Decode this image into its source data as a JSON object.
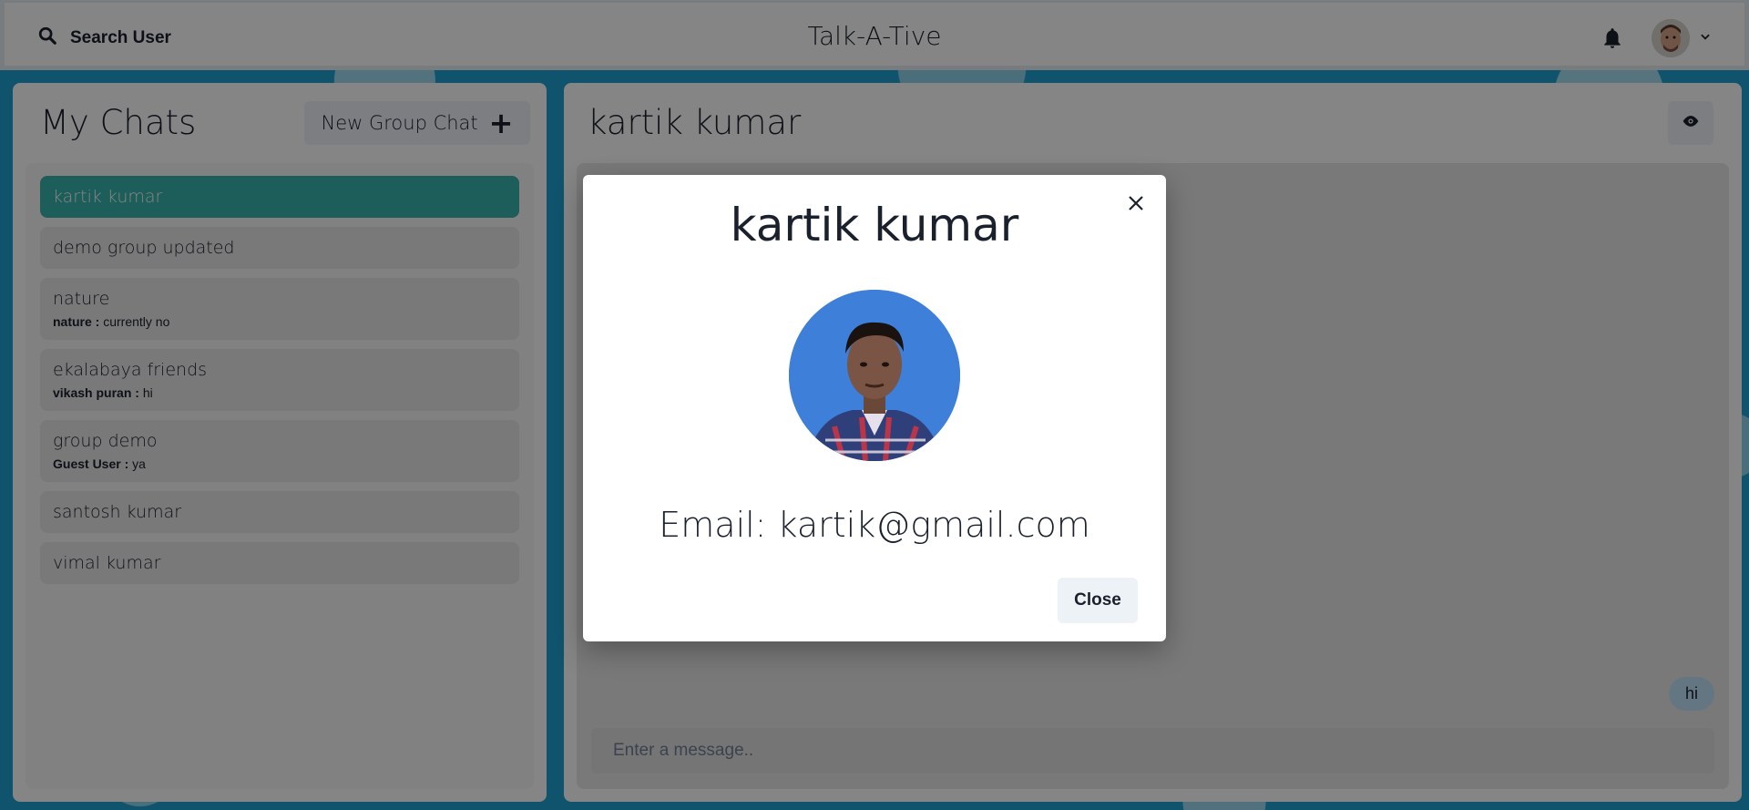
{
  "header": {
    "search_label": "Search User",
    "app_title": "Talk-A-Tive",
    "icons": [
      "search-icon",
      "bell-icon",
      "chevron-down-icon"
    ]
  },
  "sidebar": {
    "title": "My Chats",
    "new_group_label": "New Group Chat",
    "chats": [
      {
        "name": "kartik kumar",
        "active": true
      },
      {
        "name": "demo group updated"
      },
      {
        "name": "nature",
        "sender": "nature :",
        "latest": "currently no"
      },
      {
        "name": "ekalabaya friends",
        "sender": "vikash puran :",
        "latest": "hi"
      },
      {
        "name": "group demo",
        "sender": "Guest User :",
        "latest": "ya"
      },
      {
        "name": "santosh kumar"
      },
      {
        "name": "vimal kumar"
      }
    ]
  },
  "chat": {
    "title": "kartik kumar",
    "messages": [
      {
        "text": "hi"
      }
    ],
    "input_placeholder": "Enter a message.."
  },
  "modal": {
    "title": "kartik kumar",
    "email_text": "Email: kartik@gmail.com",
    "close_label": "Close"
  },
  "colors": {
    "accent": "#38b2ac",
    "bubble": "#bee3f8",
    "background": "#1e9fcf"
  }
}
